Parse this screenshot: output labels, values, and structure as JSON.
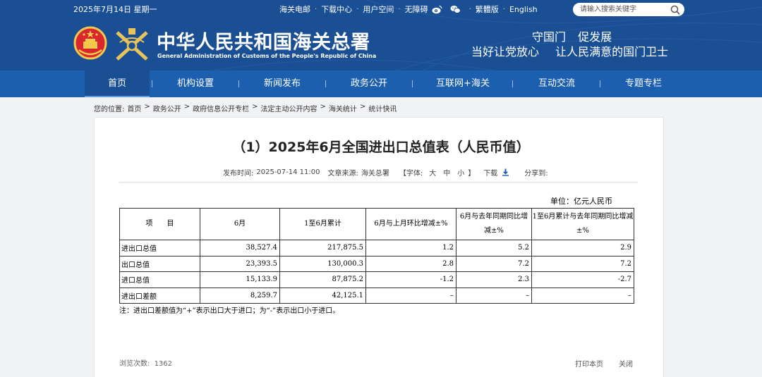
{
  "header": {
    "date": "2025年7月14日 星期一",
    "top_links": [
      "海关电邮",
      "下载中心",
      "用户空间",
      "无障碍"
    ],
    "lang_links": [
      "繁體版",
      "English"
    ],
    "search_placeholder": "请输入搜索关键字",
    "title_cn": "中华人民共和国海关总署",
    "title_en": "General Administration of Customs of the People's Republic of China",
    "slogan_line1": "守国门 促发展",
    "slogan_line2": "当好让党放心 让人民满意的国门卫士",
    "colors": {
      "header_bg": "#1a4f94",
      "nav_bg": "#1c5fae"
    }
  },
  "nav": {
    "items": [
      "首页",
      "机构设置",
      "新闻发布",
      "政务公开",
      "互联网+海关",
      "互动交流",
      "专题专栏"
    ],
    "active_index": 0
  },
  "breadcrumb": {
    "prefix": "您的位置:",
    "items": [
      "首页",
      "政务公开",
      "政府信息公开专栏",
      "法定主动公开内容",
      "海关统计",
      "统计快讯"
    ]
  },
  "article": {
    "title": "（1）2025年6月全国进出口总值表（人民币值）",
    "published_label": "发布时间:",
    "published": "2025-07-14 11:00",
    "source_label": "文章来源:",
    "source": "海关总署",
    "font_label_open": "【字体:",
    "font_sizes": [
      "大",
      "中",
      "小"
    ],
    "font_label_close": "】",
    "download_label": "下载",
    "share_label": "分享到:"
  },
  "table": {
    "unit": "单位：亿元人民币",
    "headers": [
      "项　　目",
      "6月",
      "1至6月累计",
      "6月与上月环比增减±%",
      "6月与去年同期同比增减±%",
      "1至6月累计与去年同期同比增减±%"
    ],
    "rows": [
      [
        "进出口总值",
        "38,527.4",
        "217,875.5",
        "1.2",
        "5.2",
        "2.9"
      ],
      [
        "出口总值",
        "23,393.5",
        "130,000.3",
        "2.8",
        "7.2",
        "7.2"
      ],
      [
        "进口总值",
        "15,133.9",
        "87,875.2",
        "-1.2",
        "2.3",
        "-2.7"
      ],
      [
        "进出口差额",
        "8,259.7",
        "42,125.1",
        "–",
        "–",
        "–"
      ]
    ],
    "note": "注：进出口差额值为“+”表示出口大于进口；为“-”表示出口小于进口。"
  },
  "footer": {
    "views_label": "浏览次数:",
    "views": "1362",
    "print_label": "打印本页",
    "close_label": "关闭"
  }
}
